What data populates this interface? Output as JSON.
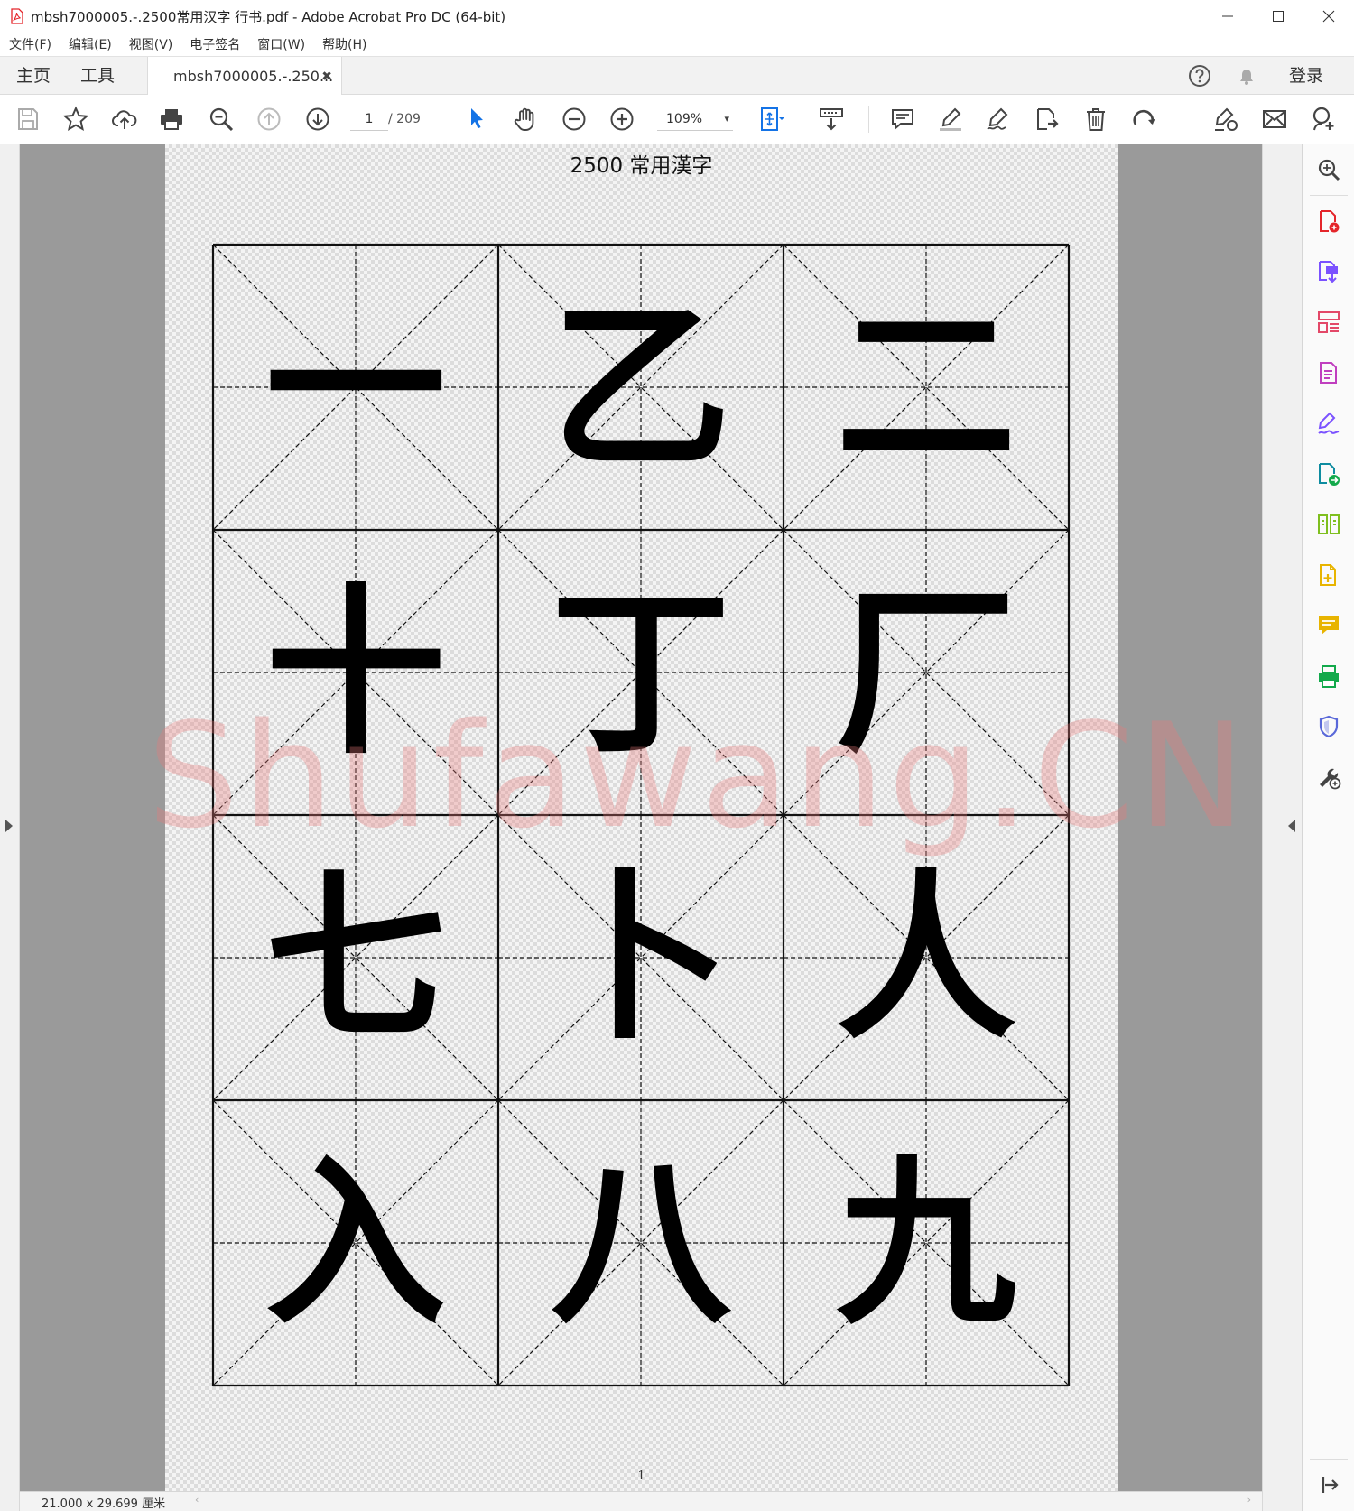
{
  "window": {
    "title": "mbsh7000005.-.2500常用汉字 行书.pdf - Adobe Acrobat Pro DC (64-bit)",
    "min_glyph": "─",
    "max_glyph": "☐",
    "close_glyph": "✕"
  },
  "menu": [
    "文件(F)",
    "编辑(E)",
    "视图(V)",
    "电子签名",
    "窗口(W)",
    "帮助(H)"
  ],
  "tabs": {
    "home": "主页",
    "tools": "工具",
    "document": "mbsh7000005.-.250...",
    "close_glyph": "✖",
    "signin": "登录"
  },
  "toolbar": {
    "page_current": "1",
    "page_total": "/ 209",
    "zoom": "109%",
    "zoom_chevron": "▾"
  },
  "page": {
    "heading": "2500 常用漢字",
    "page_number": "1",
    "watermark": "Shufawang.CN",
    "characters": [
      "一",
      "乙",
      "二",
      "十",
      "丁",
      "厂",
      "七",
      "卜",
      "人",
      "入",
      "八",
      "九"
    ]
  },
  "status": {
    "page_size": "21.000 x 29.699 厘米",
    "scroll_left": "‹",
    "scroll_right": "›",
    "scroll_up": "▲",
    "scroll_down": "▼"
  },
  "colors": {
    "accent_blue": "#1473e6",
    "pdf_red": "#e4252a",
    "tool_purple": "#7b52ff",
    "tool_green": "#12a94b",
    "tool_yellow": "#e8b400",
    "tool_teal": "#0e8ca0",
    "tool_pink": "#e34868"
  }
}
